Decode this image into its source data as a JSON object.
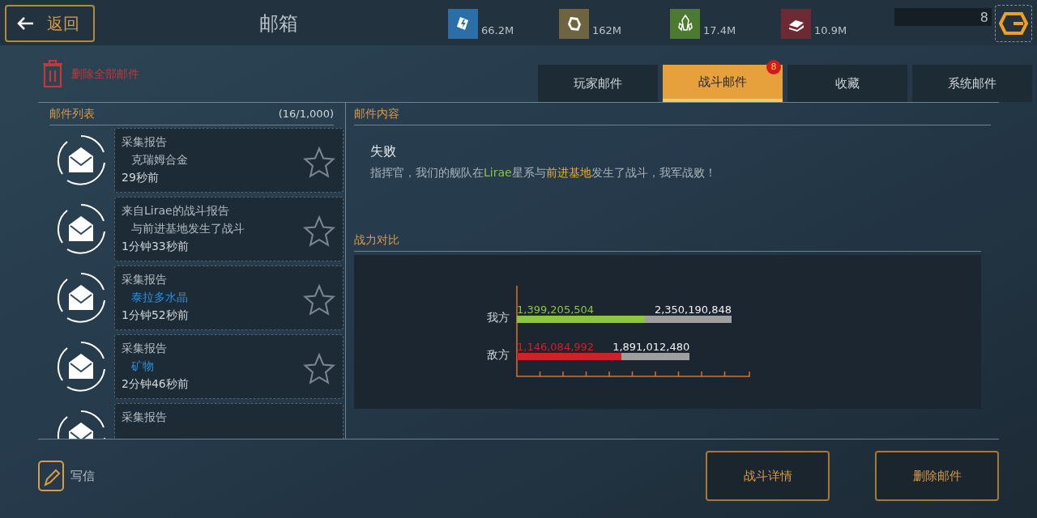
{
  "header": {
    "back": "返回",
    "title": "邮箱",
    "resources": [
      {
        "kind": "energy",
        "color": "#2a6fa8",
        "amount": "66.2M"
      },
      {
        "kind": "ore",
        "color": "#6e6540",
        "amount": "162M"
      },
      {
        "kind": "crystal",
        "color": "#4c7a2e",
        "amount": "17.4M"
      },
      {
        "kind": "alloy",
        "color": "#6e2a34",
        "amount": "10.9M"
      }
    ],
    "counter": "8"
  },
  "delete_all": "删除全部邮件",
  "tabs": [
    {
      "label": "玩家邮件",
      "selected": false
    },
    {
      "label": "战斗邮件",
      "selected": true,
      "badge": "8"
    },
    {
      "label": "收藏",
      "selected": false
    },
    {
      "label": "系统邮件",
      "selected": false
    }
  ],
  "mail_list": {
    "title": "邮件列表",
    "count": "(16/1,000)",
    "items": [
      {
        "title": "采集报告",
        "subtitle": "克瑞姆合金",
        "color": "#b4bcc2",
        "time": "29秒前"
      },
      {
        "title": "来自Lirae的战斗报告",
        "subtitle": "与前进基地发生了战斗",
        "color": "#b4bcc2",
        "time": "1分钟33秒前"
      },
      {
        "title": "采集报告",
        "subtitle": "泰拉多水晶",
        "color": "#2f8fd6",
        "time": "1分钟52秒前"
      },
      {
        "title": "采集报告",
        "subtitle": "矿物",
        "color": "#2f8fd6",
        "time": "2分钟46秒前"
      },
      {
        "title": "采集报告"
      }
    ]
  },
  "content": {
    "title": "邮件内容",
    "result": "失败",
    "message": [
      {
        "text": "指挥官，我们的舰队在",
        "kind": "plain"
      },
      {
        "text": "Lirae",
        "kind": "system"
      },
      {
        "text": "星系与",
        "kind": "plain"
      },
      {
        "text": "前进基地",
        "kind": "target"
      },
      {
        "text": "发生了战斗，我军战败！",
        "kind": "plain"
      }
    ],
    "comparison_title": "战力对比",
    "power_rows": [
      {
        "side": "我方",
        "power": "1,399,205,504",
        "total": "2,350,190,848",
        "color": "#8cc63f",
        "level": 0.595
      },
      {
        "side": "敌方",
        "power": "1,146,084,992",
        "total": "1,891,012,480",
        "color": "#d0202a",
        "level": 0.606
      }
    ]
  },
  "buttons": [
    "战斗详情",
    "删除邮件"
  ],
  "write": "写信"
}
